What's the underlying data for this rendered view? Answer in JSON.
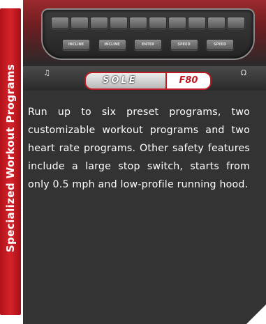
{
  "side_tab": {
    "label": "Specialized Workout Programs"
  },
  "product_image": {
    "brand": "SOLE",
    "model": "F80",
    "keypad_labels": [
      "INCLINE",
      "INCLINE",
      "ENTER",
      "SPEED",
      "SPEED"
    ],
    "icons": [
      "music-note-icon",
      "headphones-icon"
    ]
  },
  "description": "Run up to six preset programs, two customizable workout programs and two heart rate programs. Other safety features include a large stop switch, starts from only 0.5 mph and low-profile running hood.",
  "colors": {
    "tab_red": "#d5232b",
    "panel_dark": "#333333",
    "text": "#ffffff",
    "background": "#ffffff"
  }
}
